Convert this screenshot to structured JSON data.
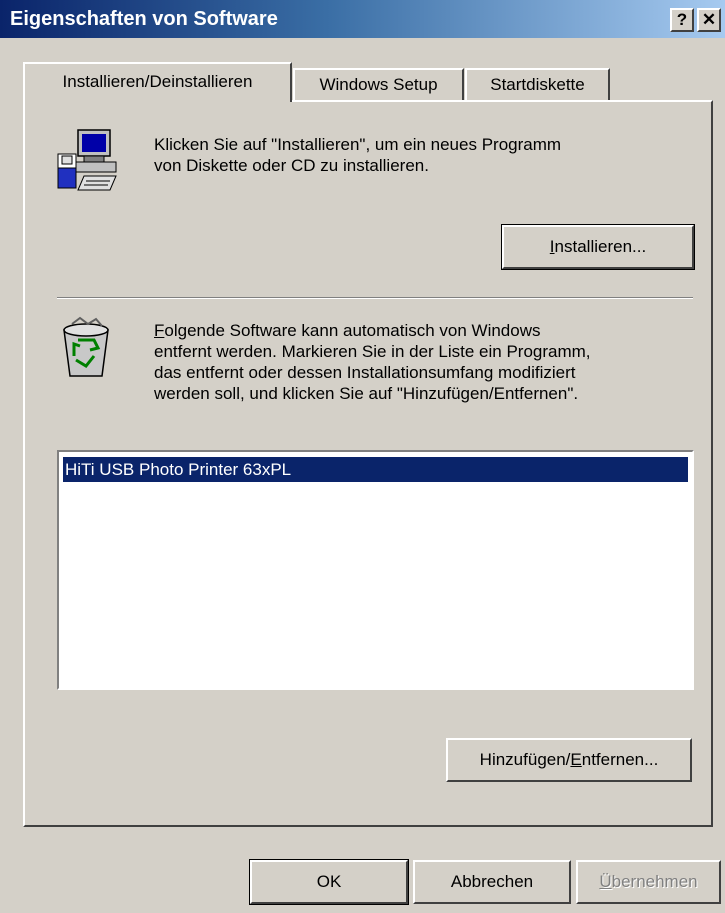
{
  "window": {
    "title": "Eigenschaften von Software",
    "help_label": "?",
    "close_label": "✕"
  },
  "tabs": [
    {
      "label": "Installieren/Deinstallieren",
      "active": true
    },
    {
      "label": "Windows Setup",
      "active": false
    },
    {
      "label": "Startdiskette",
      "active": false
    }
  ],
  "install_section": {
    "icon": "computer-install-icon",
    "text_line1": "Klicken Sie auf \"Installieren\", um ein neues Programm",
    "text_line2": "von Diskette oder CD zu installieren.",
    "button_first": "I",
    "button_rest": "nstallieren..."
  },
  "remove_section": {
    "icon": "recycle-bin-icon",
    "line1_first": "F",
    "line1_rest": "olgende Software kann automatisch von Windows",
    "line2": "entfernt werden. Markieren Sie in der Liste ein Programm,",
    "line3": "das entfernt oder dessen Installationsumfang modifiziert",
    "line4": "werden soll, und klicken Sie auf \"Hinzufügen/Entfernen\".",
    "list_items": [
      "HiTi USB Photo Printer 63xPL"
    ],
    "button_pre": "Hinzufügen/",
    "button_underline": "E",
    "button_post": "ntfernen..."
  },
  "footer": {
    "ok_label": "OK",
    "cancel_label": "Abbrechen",
    "apply_underline": "Ü",
    "apply_rest": "bernehmen"
  }
}
